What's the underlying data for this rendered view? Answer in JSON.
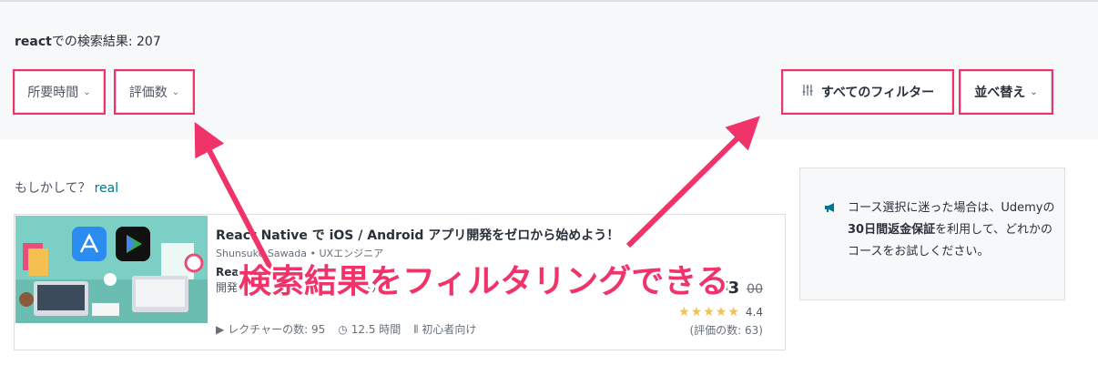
{
  "search": {
    "query": "react",
    "results_label": "での検索結果: ",
    "count": "207"
  },
  "filters": {
    "duration_label": "所要時間",
    "rating_label": "評価数",
    "all_filters_label": "すべてのフィルター",
    "sort_label": "並べ替え",
    "chevron": "⌄"
  },
  "suggestion": {
    "prefix": "もしかして？",
    "term": "real"
  },
  "course": {
    "title": "React Native で iOS / Android アプリ開発をゼロから始めよう！",
    "instructor": "Shunsuke Sawada • UXエンジニア",
    "headline_line1": "Rea",
    "headline_line2": "開発",
    "headline_fragment": "向け講",
    "price": "¥3",
    "original_price": "00",
    "rating": "4.4",
    "stars": "★★★★★",
    "rating_count": "(評価の数: 63)",
    "lectures": "レクチャーの数: 95",
    "hours": "12.5 時間",
    "level": "初心者向け"
  },
  "guarantee": {
    "text_before": "コース選択に迷った場合は、Udemyの",
    "bold": "30日間返金保証",
    "text_after": "を利用して、どれかのコースをお試しください。"
  },
  "annotation": {
    "text": "検索結果をフィルタリングできる"
  },
  "colors": {
    "accent": "#f0346a",
    "link": "#007791",
    "star": "#f4c150"
  }
}
